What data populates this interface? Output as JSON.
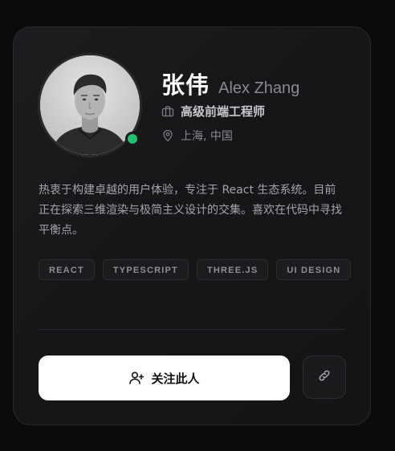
{
  "profile": {
    "name": "张伟",
    "name_en": "Alex Zhang",
    "title": "高级前端工程师",
    "location": "上海, 中国",
    "online": true,
    "bio": "热衷于构建卓越的用户体验，专注于 React 生态系统。目前正在探索三维渲染与极简主义设计的交集。喜欢在代码中寻找平衡点。"
  },
  "tags": [
    "REACT",
    "TYPESCRIPT",
    "THREE.JS",
    "UI DESIGN"
  ],
  "actions": {
    "follow_label": "关注此人",
    "follow_icon": "user-plus-icon",
    "link_icon": "link-icon"
  },
  "icons": {
    "title_icon": "briefcase-icon",
    "location_icon": "map-pin-icon"
  },
  "colors": {
    "background": "#0b0b0c",
    "card": "#161618",
    "status_online": "#22c06f",
    "button_primary": "#ffffff"
  }
}
